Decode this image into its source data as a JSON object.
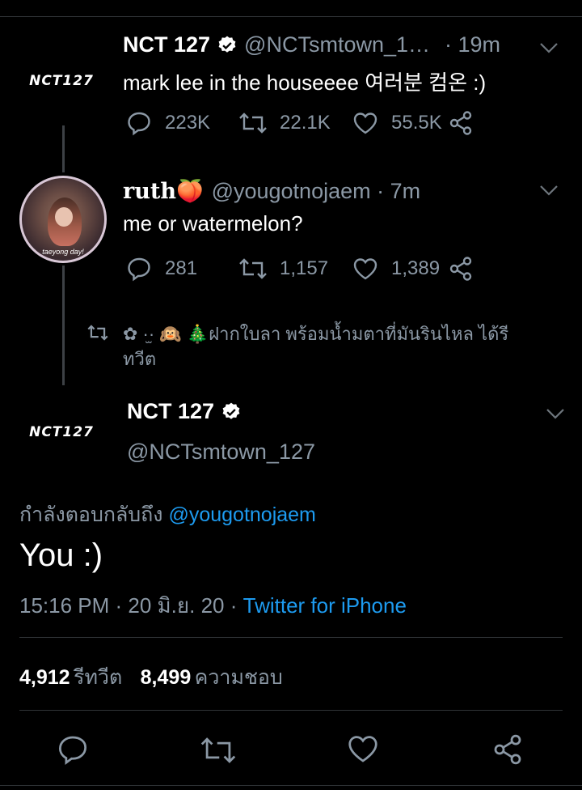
{
  "tweet1": {
    "name": "NCT 127",
    "handle": "@NCTsmtown_1…",
    "time": "· 19m",
    "text": "mark lee in the houseeee 여러분 컴온 :)",
    "logo_text": "NCT127",
    "replies": "223K",
    "retweets": "22.1K",
    "likes": "55.5K"
  },
  "tweet2": {
    "name": "ruth🍑",
    "handle": "@yougotnojaem · 7m",
    "text": "me or watermelon?",
    "avatar_caption": "taeyong day!",
    "replies": "281",
    "retweets": "1,157",
    "likes": "1,389"
  },
  "retweet_note": {
    "line1": "✿ ·̫· 🙉 🎄ฝากใบลา พร้อมน้ำมตาที่มันรินไหล ได้รี",
    "line2": "ทวีต"
  },
  "main_tweet": {
    "name": "NCT 127",
    "handle": "@NCTsmtown_127",
    "logo_text": "NCT127",
    "replying_prefix": "กำลังตอบกลับถึง",
    "replying_to": "@yougotnojaem",
    "text": "You :)",
    "time": "15:16 PM · 20 มิ.ย. 20 ·",
    "source": "Twitter for iPhone",
    "retweet_count": "4,912",
    "retweet_label": "รีทวีต",
    "like_count": "8,499",
    "like_label": "ความชอบ"
  },
  "colors": {
    "background": "#000000",
    "secondary_text": "#8b98a5",
    "link": "#1d9bf0",
    "divider": "#2f3336"
  }
}
